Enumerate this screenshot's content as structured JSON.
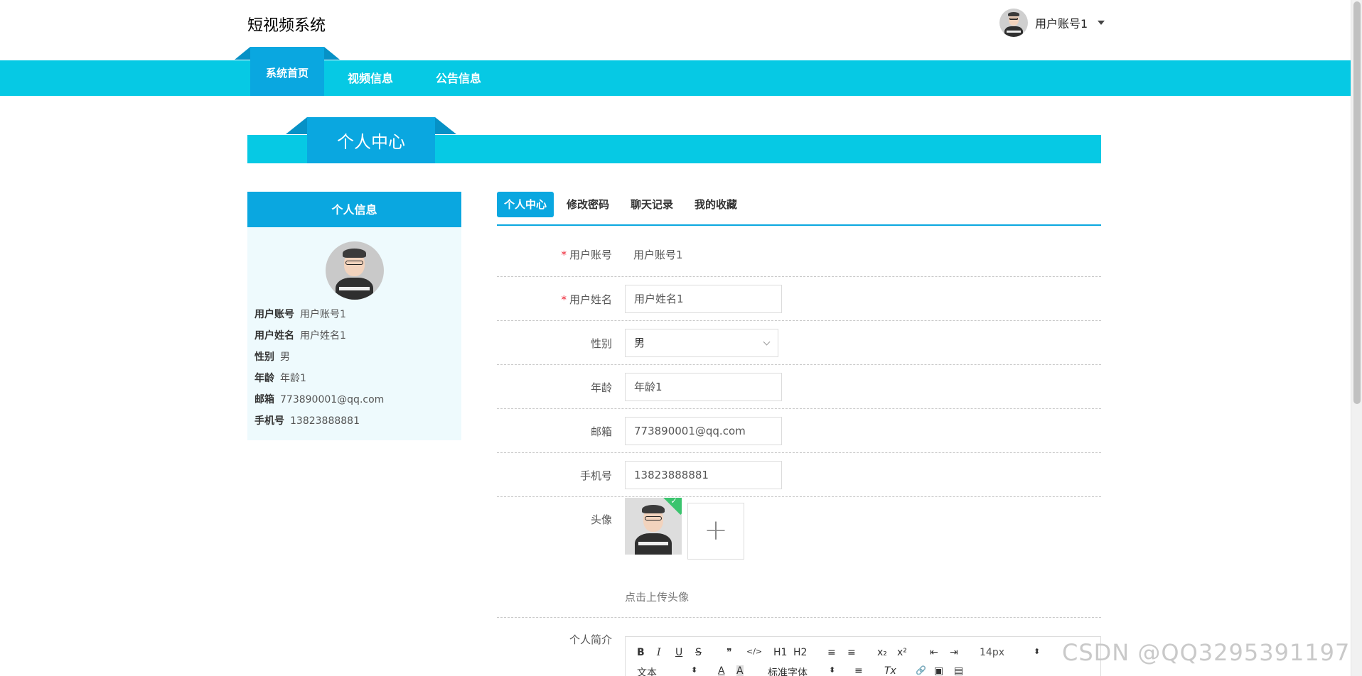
{
  "header": {
    "site_title": "短视频系统",
    "user_name": "用户账号1"
  },
  "nav": {
    "items": [
      {
        "label": "系统首页",
        "active": true
      },
      {
        "label": "视频信息",
        "active": false
      },
      {
        "label": "公告信息",
        "active": false
      }
    ]
  },
  "section": {
    "title": "个人中心"
  },
  "info_card": {
    "title": "个人信息",
    "rows": [
      {
        "label": "用户账号",
        "value": "用户账号1"
      },
      {
        "label": "用户姓名",
        "value": "用户姓名1"
      },
      {
        "label": "性别",
        "value": "男"
      },
      {
        "label": "年龄",
        "value": "年龄1"
      },
      {
        "label": "邮箱",
        "value": "773890001@qq.com"
      },
      {
        "label": "手机号",
        "value": "13823888881"
      }
    ]
  },
  "tabs": [
    {
      "label": "个人中心",
      "active": true
    },
    {
      "label": "修改密码",
      "active": false
    },
    {
      "label": "聊天记录",
      "active": false
    },
    {
      "label": "我的收藏",
      "active": false
    }
  ],
  "form": {
    "account": {
      "label": "用户账号",
      "value": "用户账号1",
      "required": true
    },
    "name": {
      "label": "用户姓名",
      "value": "用户姓名1",
      "required": true
    },
    "gender": {
      "label": "性别",
      "value": "男"
    },
    "age": {
      "label": "年龄",
      "value": "年龄1"
    },
    "email": {
      "label": "邮箱",
      "value": "773890001@qq.com"
    },
    "phone": {
      "label": "手机号",
      "value": "13823888881"
    },
    "avatar": {
      "label": "头像",
      "upload_tip": "点击上传头像",
      "add_symbol": "+"
    },
    "bio": {
      "label": "个人简介"
    }
  },
  "editor": {
    "row1": [
      "B",
      "I",
      "U",
      "S",
      "❞",
      "</>",
      "H1",
      "H2",
      "≡",
      "≡",
      "x₂",
      "x²",
      "⇤",
      "⇥",
      "14px",
      "⬍"
    ],
    "row2": [
      "文本",
      "⬍",
      "A",
      "A",
      "标准字体",
      "⬍",
      "≡",
      "Tx",
      "🔗",
      "▣",
      "▤"
    ]
  },
  "watermark": "CSDN @QQ3295391197",
  "colors": {
    "nav_bg": "#06c9e4",
    "accent": "#0aa7e0",
    "card_bg": "#eefafd",
    "success": "#3bc46e"
  }
}
